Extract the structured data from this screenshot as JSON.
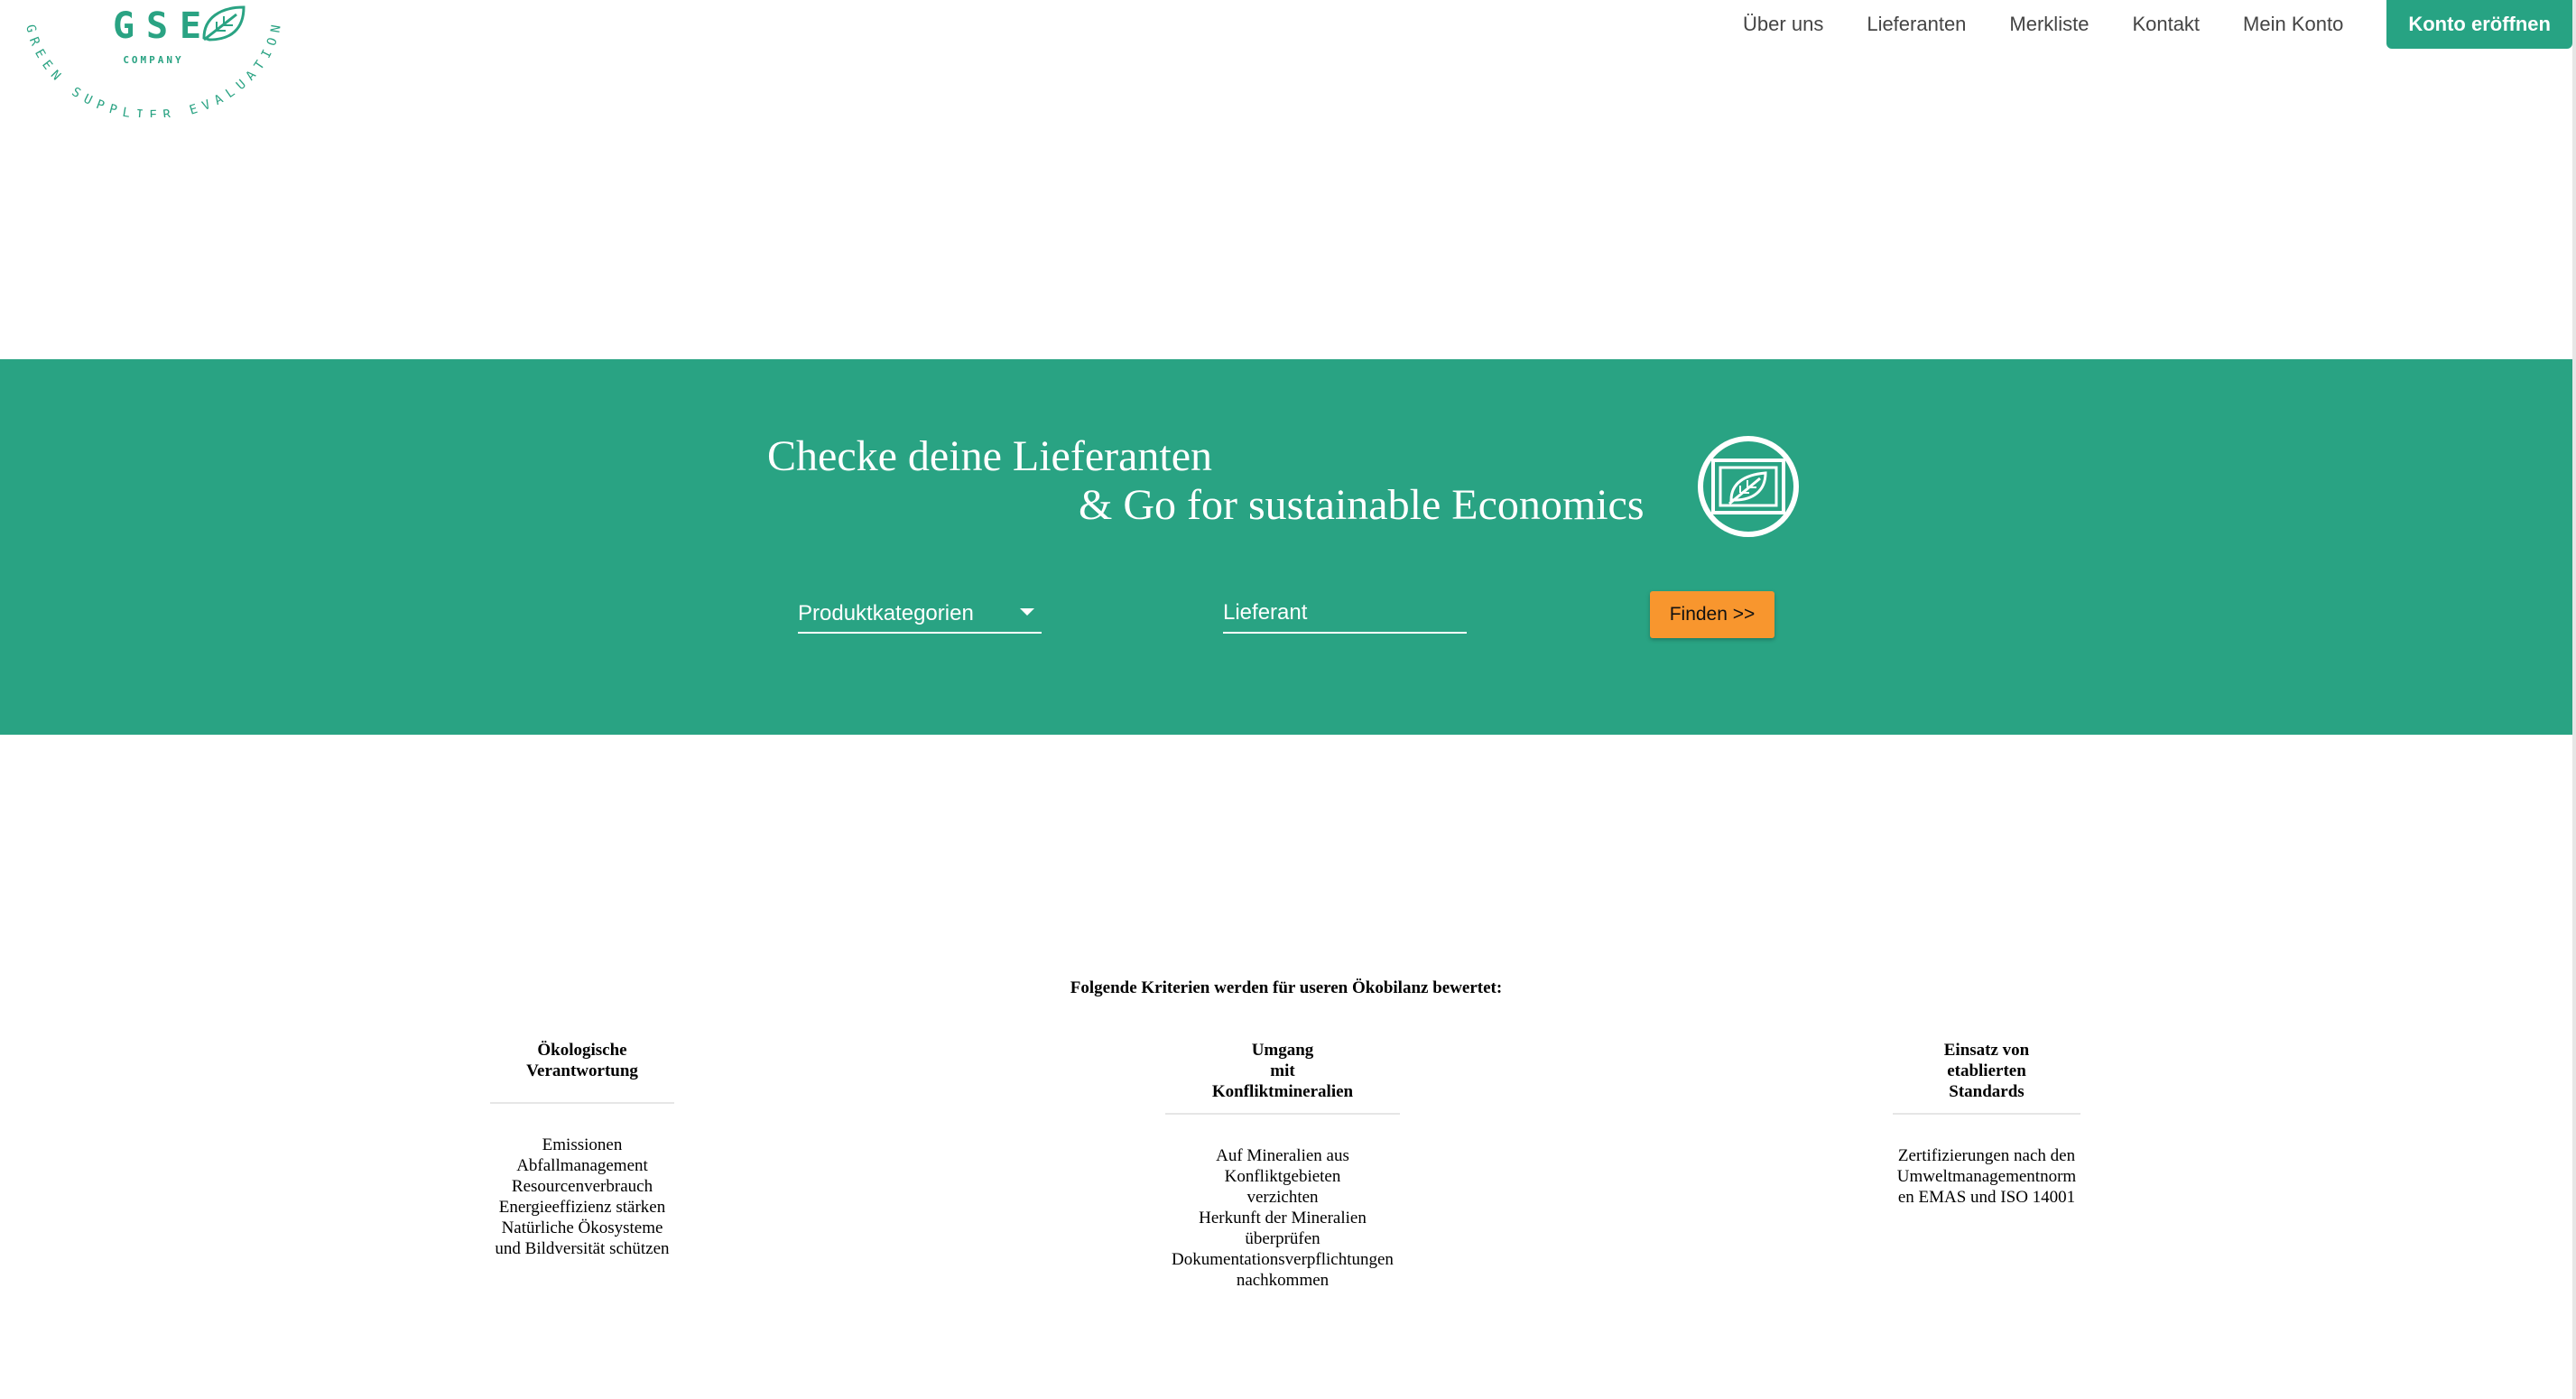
{
  "logo": {
    "letters": [
      "G",
      "S",
      "E"
    ],
    "company": "COMPANY",
    "tagline": "GREEN SUPPLIER EVALUATION",
    "icon": "leaf-icon"
  },
  "nav": {
    "items": [
      {
        "label": "Über uns"
      },
      {
        "label": "Lieferanten"
      },
      {
        "label": "Merkliste"
      },
      {
        "label": "Kontakt"
      },
      {
        "label": "Mein Konto"
      }
    ],
    "cta_label": "Konto eröffnen"
  },
  "hero": {
    "line1": "Checke deine Lieferanten",
    "line2": "& Go for sustainable Economics",
    "icon": "leaf-frame-icon",
    "category_select": {
      "label": "Produktkategorien"
    },
    "supplier_input": {
      "placeholder": "Lieferant",
      "value": ""
    },
    "find_label": "Finden >>"
  },
  "criteria": {
    "title": "Folgende Kriterien werden für useren Ökobilanz bewertet:",
    "columns": [
      {
        "heading": [
          "Ökologische",
          "Verantwortung"
        ],
        "items": [
          "Emissionen",
          "Abfallmanagement",
          "Resourcenverbrauch",
          "Energieeffizienz stärken",
          "Natürliche Ökosysteme",
          "und Bildversität schützen"
        ]
      },
      {
        "heading": [
          "Umgang",
          "mit",
          "Konfliktmineralien"
        ],
        "items": [
          "Auf Mineralien aus",
          "Konfliktgebieten",
          "verzichten",
          "Herkunft der Mineralien",
          "überprüfen",
          "Dokumentationsverpflichtungen",
          "nachkommen"
        ]
      },
      {
        "heading": [
          "Einsatz von",
          "etablierten",
          "Standards"
        ],
        "items": [
          "Zertifizierungen nach den",
          "Umweltmanagementnorm",
          "en EMAS und ISO 14001"
        ]
      }
    ]
  },
  "colors": {
    "brand_green": "#29a383",
    "button_orange": "#f8962e",
    "text_white": "#ffffff"
  }
}
